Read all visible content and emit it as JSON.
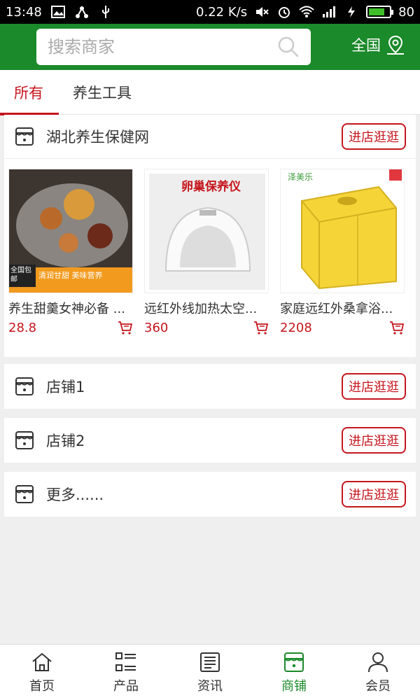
{
  "status_bar": {
    "time": "13:48",
    "net_speed": "0.22 K/s",
    "battery": "80",
    "battery_level": 0.8
  },
  "header": {
    "search_placeholder": "搜索商家",
    "region": "全国"
  },
  "tabs": [
    {
      "label": "所有",
      "active": true
    },
    {
      "label": "养生工具",
      "active": false
    }
  ],
  "featured_shop": {
    "name": "湖北养生保健网",
    "visit_label": "进店逛逛",
    "products": [
      {
        "title": "养生甜羹女神必备 ...",
        "price": "28.8",
        "img_text_1": "清润甘甜 美味营养",
        "img_badge": "全国包邮"
      },
      {
        "title": "远红外线加热太空...",
        "price": "360",
        "img_text_1": "卵巢保养仪"
      },
      {
        "title": "家庭远红外桑拿浴...",
        "price": "2208",
        "img_text_1": "泽美乐"
      }
    ]
  },
  "shops": [
    {
      "name": "店铺1",
      "visit_label": "进店逛逛"
    },
    {
      "name": "店铺2",
      "visit_label": "进店逛逛"
    },
    {
      "name": "更多......",
      "visit_label": "进店逛逛"
    }
  ],
  "bottom_nav": [
    {
      "label": "首页",
      "icon": "home-icon",
      "active": false
    },
    {
      "label": "产品",
      "icon": "list-icon",
      "active": false
    },
    {
      "label": "资讯",
      "icon": "news-icon",
      "active": false
    },
    {
      "label": "商铺",
      "icon": "shop-icon",
      "active": true
    },
    {
      "label": "会员",
      "icon": "user-icon",
      "active": false
    }
  ],
  "colors": {
    "brand_green": "#1b8a2a",
    "accent_red": "#c5161d"
  }
}
